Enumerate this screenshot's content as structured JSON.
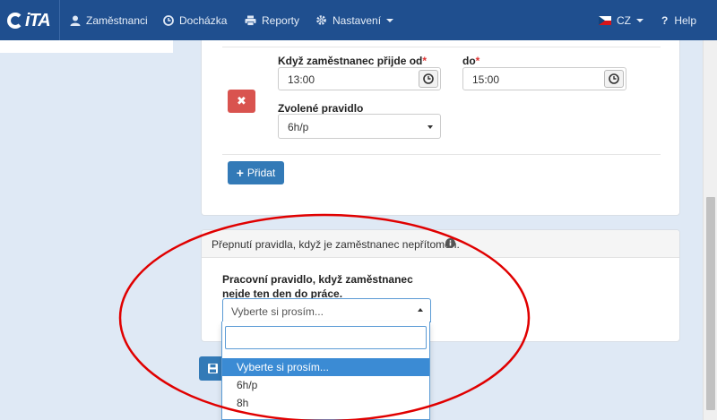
{
  "nav": {
    "brand": "iTA",
    "items": [
      {
        "label": "Zaměstnanci",
        "icon": "user-icon"
      },
      {
        "label": "Docházka",
        "icon": "clock-icon"
      },
      {
        "label": "Reporty",
        "icon": "printer-icon"
      },
      {
        "label": "Nastavení",
        "icon": "gear-icon"
      }
    ],
    "language": "CZ",
    "help": "Help"
  },
  "rule_form": {
    "arrival_from_label": "Když zaměstnanec přijde od",
    "arrival_from_value": "13:00",
    "arrival_to_label": "do",
    "arrival_to_value": "15:00",
    "selected_rule_label": "Zvolené pravidlo",
    "selected_rule_value": "6h/p",
    "required_mark": "*",
    "delete_label": "✖",
    "add_label": "Přidat"
  },
  "absence_section": {
    "title": "Přepnutí pravidla, když je zaměstnanec nepřítomen.",
    "rule_label": "Pracovní pravidlo, když zaměstnanec nejde ten den do práce.",
    "select_value": "Vyberte si prosím...",
    "search_value": "",
    "options": [
      "Vyberte si prosím...",
      "6h/p",
      "8h"
    ]
  },
  "colors": {
    "navbar": "#1f4f8f",
    "primary": "#337ab7",
    "danger": "#d9534f",
    "annotation": "#e00000"
  }
}
